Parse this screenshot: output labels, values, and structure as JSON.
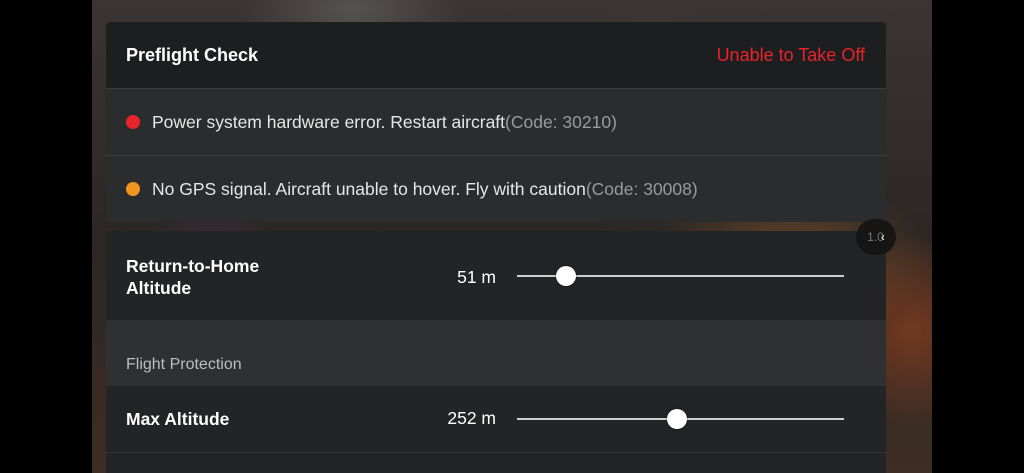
{
  "preflight": {
    "title": "Preflight Check",
    "status": "Unable to Take Off",
    "status_color": "#e8232c",
    "warnings": [
      {
        "severity": "error",
        "color": "#e8232c",
        "message": "Power system hardware error. Restart aircraft",
        "code": "(Code: 30210)"
      },
      {
        "severity": "warning",
        "color": "#f0961e",
        "message": "No GPS signal. Aircraft unable to hover. Fly with caution",
        "code": "(Code: 30008)"
      }
    ]
  },
  "collapse_button": {
    "ghost_text": "1.0",
    "icon": "chevron-left-icon",
    "glyph": "‹"
  },
  "settings": {
    "rth_altitude": {
      "label": "Return-to-Home Altitude",
      "value": "51 m",
      "slider_fraction": 0.15
    },
    "section_flight_protection": "Flight Protection",
    "max_altitude": {
      "label": "Max Altitude",
      "value": "252 m",
      "slider_fraction": 0.49
    }
  }
}
